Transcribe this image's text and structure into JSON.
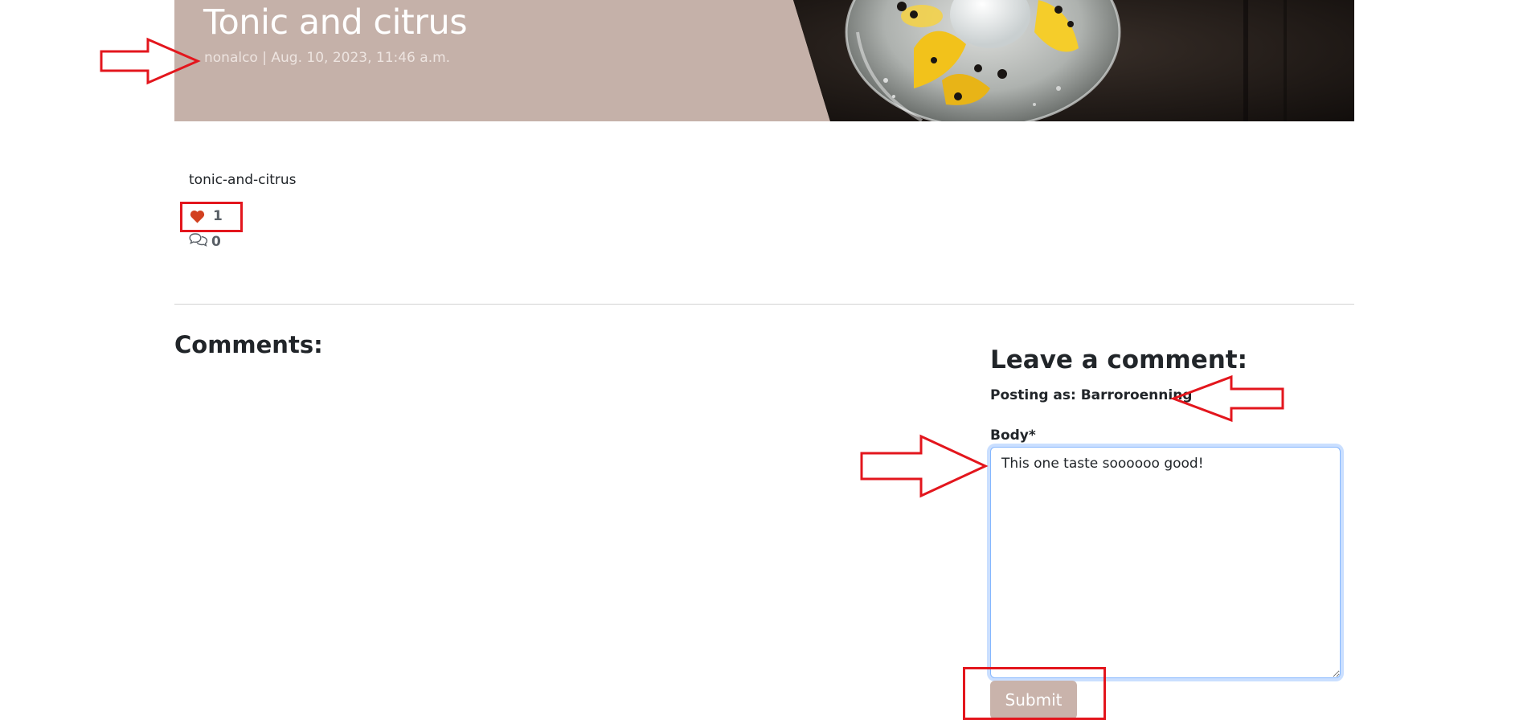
{
  "post": {
    "title": "Tonic and citrus",
    "meta": "nonalco | Aug. 10, 2023, 11:46 a.m.",
    "content": "tonic-and-citrus",
    "like_count": "1",
    "comment_count": "0",
    "hero_image_subject": "gin tonic glass with ice, lemon and peppercorns"
  },
  "comments": {
    "heading": "Comments:"
  },
  "comment_form": {
    "heading": "Leave a comment:",
    "posting_as": "Posting as: Barroroenning",
    "body_label": "Body*",
    "body_value": "This one taste soooooo good!",
    "submit_label": "Submit"
  },
  "icons": {
    "like": "heart-icon",
    "comments": "speech-bubbles-icon"
  },
  "colors": {
    "hero_background": "#c5b1a9",
    "like_heart": "#d2401f",
    "submit_background": "#c9b3ab",
    "annotation_red": "#e3161d",
    "focus_outline": "#86b7fe"
  }
}
